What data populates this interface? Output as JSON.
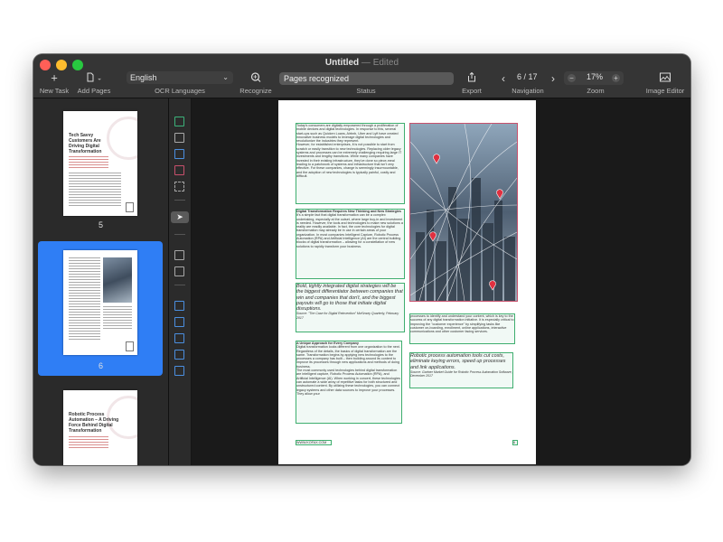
{
  "window": {
    "title": "Untitled",
    "separator": "—",
    "edited": "Edited"
  },
  "toolbar": {
    "new_task": "New Task",
    "add_pages": "Add Pages",
    "ocr_languages_label": "OCR Languages",
    "language_value": "English",
    "recognize": "Recognize",
    "status_label": "Status",
    "status_value": "Pages recognized",
    "export": "Export",
    "navigation": "Navigation",
    "page_indicator": "6 / 17",
    "zoom_label": "Zoom",
    "zoom_value": "17%",
    "image_editor": "Image Editor"
  },
  "thumbnails": [
    {
      "number": "5",
      "title": "Tech Savvy Customers Are Driving Digital Transformation"
    },
    {
      "number": "6"
    },
    {
      "title": "Robotic Process Automation – A Driving Force Behind Digital Transformation"
    }
  ],
  "page": {
    "col1_para1": "Today's consumers are digitally empowered through a proliferation of mobile devices and digital technologies. In response to this, several start-ups such as Quicken Loans, Airbnb, Uber and Lyft have created innovative business models to leverage digital technologies and revolutionize the industries they represent.",
    "col1_para2": "However, for established enterprises, it is not possible to start from scratch or easily transition to new technologies. Replacing older legacy systems and processes can be extremely challenging requiring large IT investments and lengthy transitions. While many companies have invested in their existing infrastructure, they've done so piece-meal leading to a patchwork of systems and infrastructure that isn't very effective. For these companies, change is seemingly insurmountable, and the adoption of new technologies is typically painful, costly and difficult.",
    "col1_heading": "Digital Transformation Requires New Thinking and New Strategies",
    "col1_para3": "It's a simple fact that digital transformation can be a complex undertaking, especially at the outset, where large buy-in and investment is needed. However, the tools and technologies to make new solutions a reality are readily available. In fact, the core technologies for digital transformation may already be in use in certain areas of your organization. In most companies Intelligent Capture, Robotic Process Automation (RPA) and Artificial Intelligence (AI) are the central building blocks of digital transformation – allowing for a constellation of new solutions to rapidly transform your business.",
    "quote1": "Bold, tightly integrated digital strategies will be the biggest differentiator between companies that win and companies that don't, and the biggest payouts will go to those that initiate digital disruptions.",
    "quote1_source": "Source: \"The Case for Digital Reinvention\" McKinsey Quarterly, February 2017",
    "col2_para1": "processes to identify and understand your content, which is key to the success of any digital transformation initiative. It is especially critical to improving the \"customer experience\" by simplifying tasks like customer on-boarding, enrollment, online applications, interactive communications and other customer facing services.",
    "col1b_heading": "A Unique Approach for Every Company",
    "col1b_para1": "Digital transformation looks different from one organization to the next. Regardless of the details, the basics of digital transformation are the same. Transformation begins by applying new technologies to the processes a company has built – then building around its content to improve its processes through new applications and methods of doing business.",
    "col1b_para2": "The most commonly used technologies behind digital transformation are intelligent capture, Robotic Process Automation (RPA), and Artificial Intelligence (AI). When working in concert, these technologies can automate a wide array of repetitive tasks for both structured and unstructured content. By utilizing these technologies, you can connect legacy systems and other data sources to improve your processes. They allow your",
    "quote2": "Robotic process automation tools cut costs, eliminate keying errors, speed up processes and link applications.",
    "quote2_source": "Source: Gartner Market Guide for Robotic Process Automation Software, December 2017",
    "footer_url": "WWW.KOFAX.COM",
    "footer_page": "6"
  },
  "colors": {
    "selection": "#2f7ef5",
    "text_block_border": "#3fae6f",
    "image_block_border": "#c8506c",
    "status_field_bg": "#595959"
  },
  "icons": [
    "plus-icon",
    "document-icon",
    "chevron-down-icon",
    "recognize-icon",
    "share-icon",
    "chevron-left-icon",
    "chevron-right-icon",
    "minus-icon",
    "plus-icon",
    "image-icon"
  ]
}
